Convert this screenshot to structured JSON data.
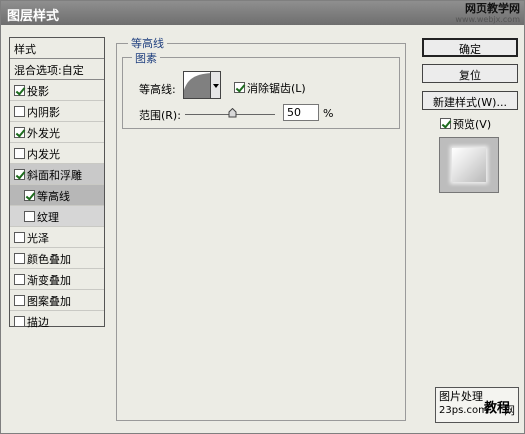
{
  "window": {
    "title": "图层样式"
  },
  "watermark_top": {
    "line1": "网页教学网",
    "line2": "www.webjx.com"
  },
  "styles_panel": {
    "header": "样式",
    "blend_options": "混合选项:自定",
    "items": [
      {
        "label": "投影",
        "checked": true
      },
      {
        "label": "内阴影",
        "checked": false
      },
      {
        "label": "外发光",
        "checked": true
      },
      {
        "label": "内发光",
        "checked": false
      },
      {
        "label": "斜面和浮雕",
        "checked": true
      },
      {
        "label": "等高线",
        "checked": true
      },
      {
        "label": "纹理",
        "checked": false
      },
      {
        "label": "光泽",
        "checked": false
      },
      {
        "label": "颜色叠加",
        "checked": false
      },
      {
        "label": "渐变叠加",
        "checked": false
      },
      {
        "label": "图案叠加",
        "checked": false
      },
      {
        "label": "描边",
        "checked": false
      }
    ]
  },
  "contour_group": {
    "title": "等高线",
    "subtitle": "图素",
    "contour_label": "等高线:",
    "antialias_label": "消除锯齿(L)",
    "antialias_checked": true,
    "range_label": "范围(R):",
    "range_value": "50",
    "range_unit": "%"
  },
  "buttons": {
    "ok": "确定",
    "reset": "复位",
    "new_style": "新建样式(W)...",
    "preview_label": "预览(V)",
    "preview_checked": true
  },
  "watermark_bottom": {
    "line1": "图片处理",
    "line2": "23ps.com",
    "line3": "教程",
    "line4": "网"
  }
}
